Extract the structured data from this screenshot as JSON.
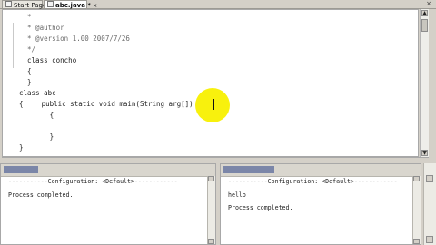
{
  "tabs": [
    {
      "label": "Start Page",
      "close": "×"
    },
    {
      "label": "abc.java *",
      "close": "×"
    }
  ],
  "window": {
    "close_all": "×"
  },
  "editor": {
    "lines": [
      "  *",
      "  * @author",
      "  * @version 1.00 2007/7/26",
      "  */",
      "  class concho",
      "  {",
      "  }",
      "class abc",
      "{",
      "     public static void main(String arg[])",
      "       {",
      "",
      "       }",
      "}"
    ]
  },
  "output_left": {
    "config": "-----------Configuration: <Default>------------",
    "line1": "Process completed."
  },
  "output_right": {
    "config": "-----------Configuration: <Default>------------",
    "line1": "hello",
    "line2": "Process completed."
  }
}
